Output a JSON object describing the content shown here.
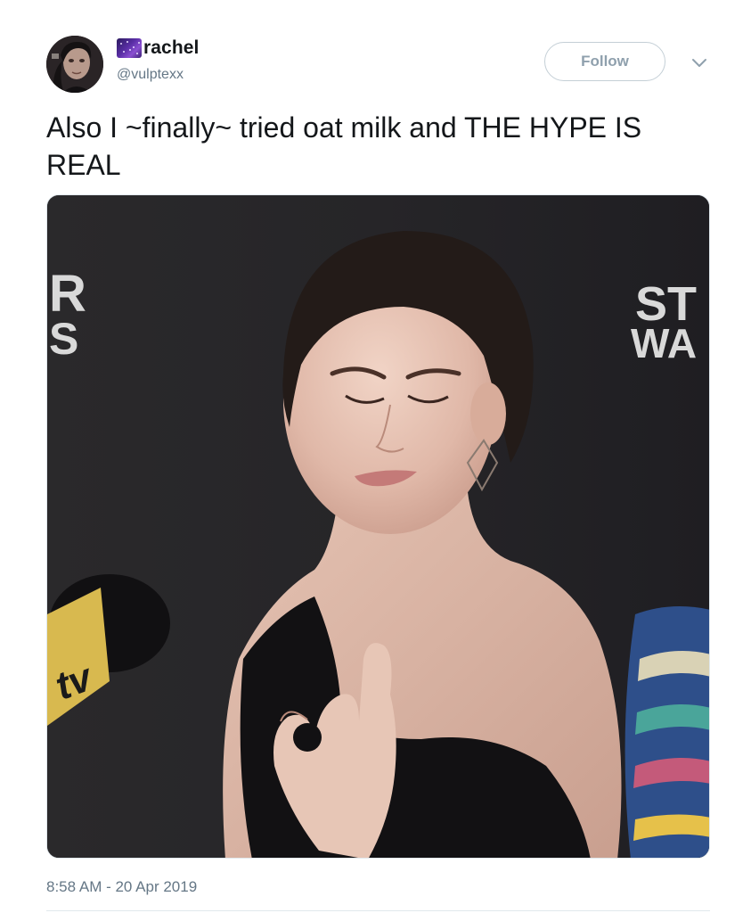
{
  "tweet": {
    "display_name": "rachel",
    "handle": "@vulptexx",
    "follow_label": "Follow",
    "text": "Also I ~finally~ tried oat milk and THE HYPE IS REAL",
    "timestamp": "8:58 AM - 20 Apr 2019"
  },
  "media": {
    "backdrop_left_text": "R\nS",
    "backdrop_right_text": "ST\nWA",
    "mic_flag_text": "tv"
  },
  "icons": {
    "name_emoji": "galaxy-emoji-icon",
    "caret": "chevron-down-icon"
  },
  "colors": {
    "text": "#14171a",
    "secondary": "#657786",
    "follow_border": "#c4cfd6",
    "follow_text": "#8fa0ad",
    "backdrop": "#2b2a2c"
  }
}
